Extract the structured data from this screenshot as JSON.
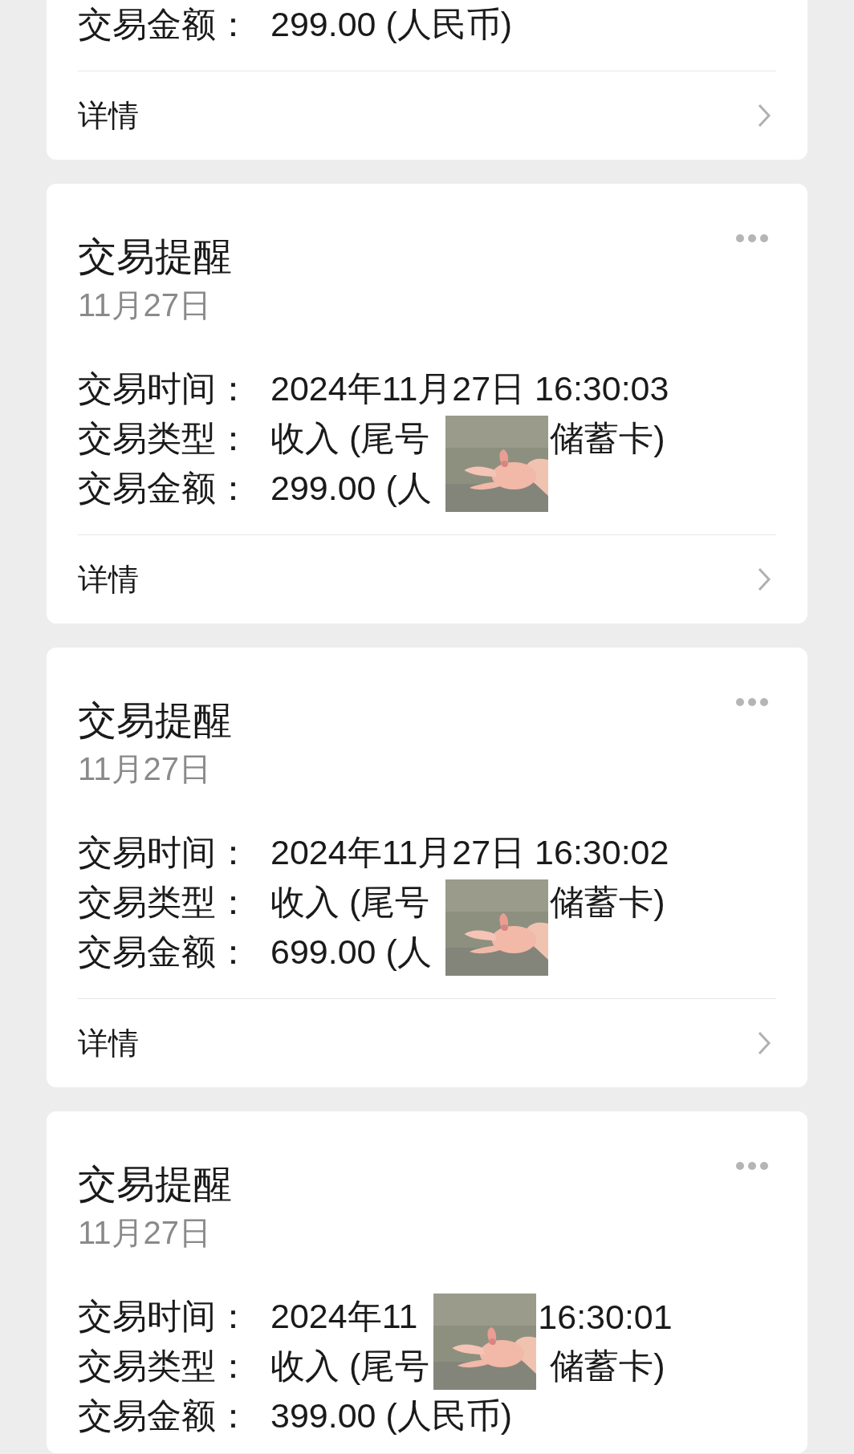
{
  "cards": [
    {
      "lines": [
        {
          "label": "交易金额：",
          "parts": [
            "299.00 (人民币)"
          ]
        }
      ],
      "detail": "详情"
    },
    {
      "title": "交易提醒",
      "date": "11月27日",
      "menu": true,
      "detail": "详情",
      "lines": [
        {
          "label": "交易时间：",
          "parts": [
            "2024年11月27日 16:30:03"
          ]
        },
        {
          "label": "交易类型：",
          "parts": [
            "收入 (尾号",
            "储蓄卡)"
          ],
          "sticker": true
        },
        {
          "label": "交易金额：",
          "parts": [
            "299.00 (人"
          ]
        }
      ]
    },
    {
      "title": "交易提醒",
      "date": "11月27日",
      "menu": true,
      "detail": "详情",
      "lines": [
        {
          "label": "交易时间：",
          "parts": [
            "2024年11月27日 16:30:02"
          ]
        },
        {
          "label": "交易类型：",
          "parts": [
            "收入 (尾号",
            "储蓄卡)"
          ],
          "sticker": true
        },
        {
          "label": "交易金额：",
          "parts": [
            "699.00 (人"
          ]
        }
      ]
    },
    {
      "title": "交易提醒",
      "date": "11月27日",
      "menu": true,
      "lines": [
        {
          "label": "交易时间：",
          "parts": [
            "2024年11",
            "16:30:01"
          ],
          "sticker": true
        },
        {
          "label": "交易类型：",
          "parts": [
            "收入 (尾号",
            "储蓄卡)"
          ]
        },
        {
          "label": "交易金额：",
          "parts": [
            "399.00 (人民币)"
          ]
        }
      ]
    }
  ]
}
